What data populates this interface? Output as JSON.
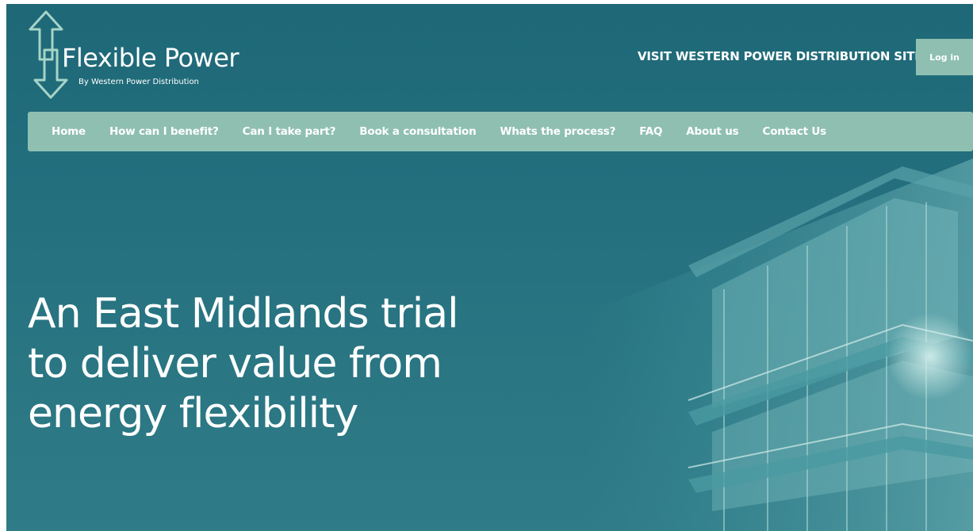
{
  "brand": {
    "title": "Flexible Power",
    "subtitle": "By Western Power Distribution",
    "icon": "up-down-arrow-icon"
  },
  "header": {
    "visit_link": "VISIT WESTERN POWER DISTRIBUTION SITE",
    "login_label": "Log in"
  },
  "nav": {
    "items": [
      {
        "label": "Home"
      },
      {
        "label": "How can I benefit?"
      },
      {
        "label": "Can I take part?"
      },
      {
        "label": "Book a consultation"
      },
      {
        "label": "Whats the process?"
      },
      {
        "label": "FAQ"
      },
      {
        "label": "About us"
      },
      {
        "label": "Contact Us"
      }
    ]
  },
  "hero": {
    "lines": [
      "An East Midlands trial",
      "to deliver value from",
      "energy flexibility"
    ]
  },
  "colors": {
    "background": "#236f7e",
    "nav_bar": "#8fbfb1",
    "login_button": "#8fbfb1",
    "text": "#ffffff"
  }
}
